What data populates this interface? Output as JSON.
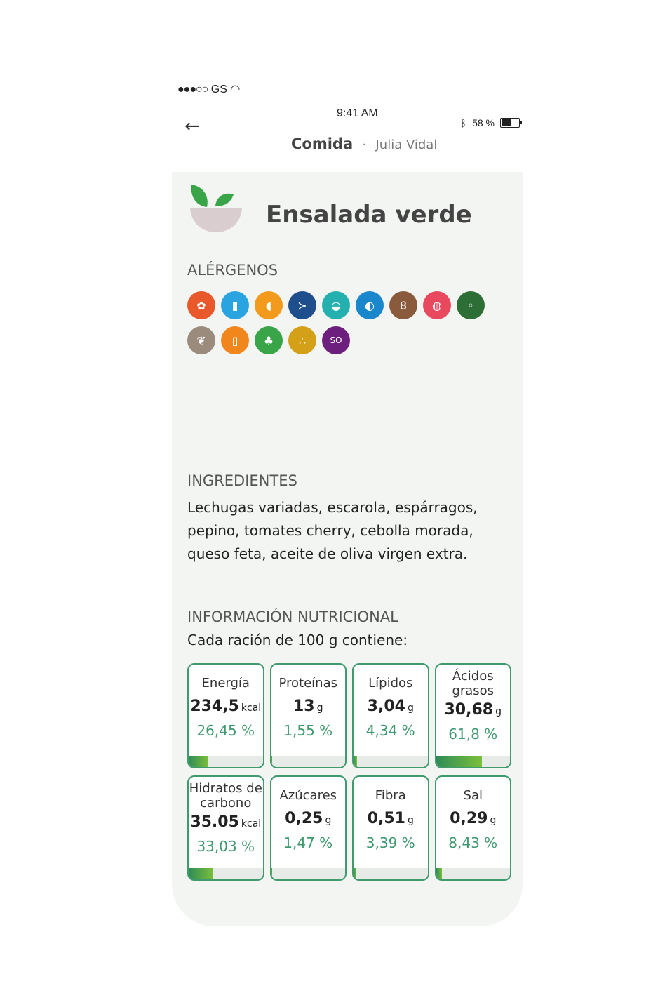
{
  "status_bar": {
    "carrier": "GS",
    "time": "9:41 AM",
    "battery_percent": "58 %"
  },
  "nav": {
    "back_icon": "arrow-left-icon",
    "title": "Comida",
    "separator": "·",
    "subtitle": "Julia Vidal"
  },
  "dish": {
    "icon": "salad-bowl-icon",
    "title": "Ensalada verde"
  },
  "allergens": {
    "label": "ALÉRGENOS",
    "items": [
      {
        "icon": "gluten-icon",
        "color": "#e8582a",
        "glyph": "✿"
      },
      {
        "icon": "milk-icon",
        "color": "#2aa4e0",
        "glyph": "▮"
      },
      {
        "icon": "egg-icon",
        "color": "#f29a1c",
        "glyph": "◖"
      },
      {
        "icon": "fish-icon",
        "color": "#1e4e8c",
        "glyph": "≻"
      },
      {
        "icon": "shellfish-icon",
        "color": "#25b0b0",
        "glyph": "◒"
      },
      {
        "icon": "mollusc-icon",
        "color": "#1a86cc",
        "glyph": "◐"
      },
      {
        "icon": "peanut-icon",
        "color": "#8a5a3c",
        "glyph": "8"
      },
      {
        "icon": "nuts-icon",
        "color": "#e9495f",
        "glyph": "◍"
      },
      {
        "icon": "soy-icon",
        "color": "#2c6e35",
        "glyph": "◦"
      },
      {
        "icon": "lupin-icon",
        "color": "#9b8b7c",
        "glyph": "❦"
      },
      {
        "icon": "mustard-icon",
        "color": "#f0861c",
        "glyph": "▯"
      },
      {
        "icon": "celery-icon",
        "color": "#3aa548",
        "glyph": "♣"
      },
      {
        "icon": "sesame-icon",
        "color": "#d4a017",
        "glyph": "∴"
      },
      {
        "icon": "sulphites-icon",
        "color": "#6d1f7d",
        "glyph": "SO"
      }
    ]
  },
  "ingredients": {
    "label": "INGREDIENTES",
    "text": "Lechugas variadas, escarola, espárragos, pepino, tomates cherry, cebolla morada, queso feta, aceite de oliva virgen extra."
  },
  "nutrition": {
    "label": "INFORMACIÓN NUTRICIONAL",
    "subtitle": "Cada ración de 100 g contiene:",
    "items": [
      {
        "name": "Energía",
        "value": "234,5",
        "unit": "kcal",
        "percent": "26,45 %",
        "fraction": 0.2645
      },
      {
        "name": "Proteínas",
        "value": "13",
        "unit": "g",
        "percent": "1,55 %",
        "fraction": 0.0155
      },
      {
        "name": "Lípidos",
        "value": "3,04",
        "unit": "g",
        "percent": "4,34 %",
        "fraction": 0.0434
      },
      {
        "name": "Ácidos grasos",
        "value": "30,68",
        "unit": "g",
        "percent": "61,8 %",
        "fraction": 0.618
      },
      {
        "name": "Hidratos de carbono",
        "value": "35.05",
        "unit": "kcal",
        "percent": "33,03 %",
        "fraction": 0.3303
      },
      {
        "name": "Azúcares",
        "value": "0,25",
        "unit": "g",
        "percent": "1,47 %",
        "fraction": 0.0147
      },
      {
        "name": "Fibra",
        "value": "0,51",
        "unit": "g",
        "percent": "3,39 %",
        "fraction": 0.0339
      },
      {
        "name": "Sal",
        "value": "0,29",
        "unit": "g",
        "percent": "8,43 %",
        "fraction": 0.0843
      }
    ]
  }
}
